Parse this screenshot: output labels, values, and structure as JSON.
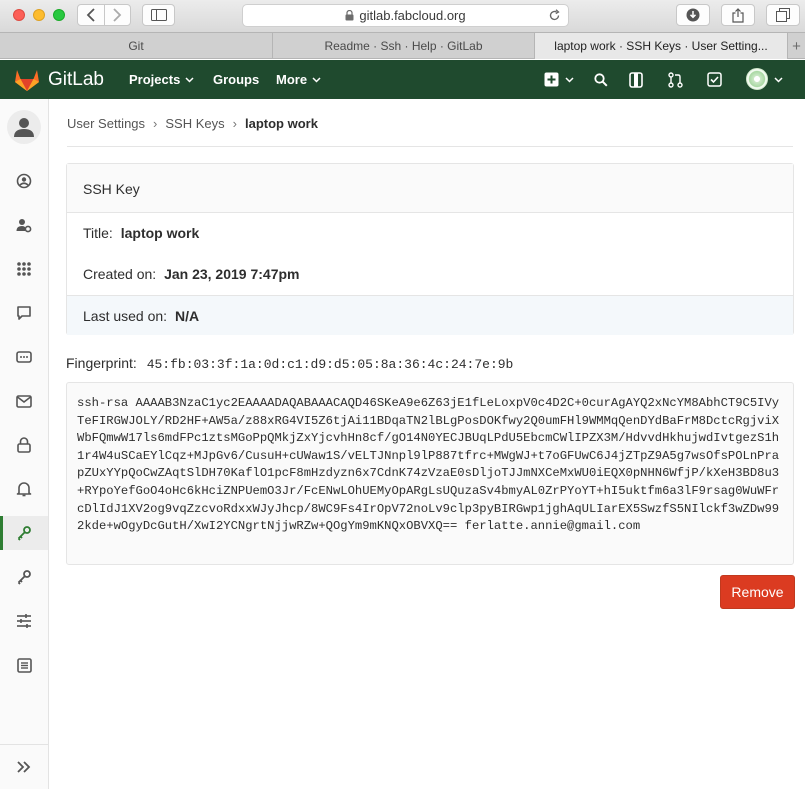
{
  "browser": {
    "url": "gitlab.fabcloud.org",
    "tabs": [
      {
        "label": "Git"
      },
      {
        "label": "Readme · Ssh · Help · GitLab"
      },
      {
        "label": "laptop work · SSH Keys · User Setting..."
      }
    ],
    "new_tab_label": "+"
  },
  "header": {
    "brand": "GitLab",
    "nav": [
      {
        "label": "Projects"
      },
      {
        "label": "Groups"
      },
      {
        "label": "More"
      }
    ],
    "colors": {
      "header_bg": "#1f4a2e",
      "danger": "#db3b21"
    }
  },
  "breadcrumb": {
    "items": [
      "User Settings",
      "SSH Keys",
      "laptop work"
    ]
  },
  "ssh_key": {
    "panel_title": "SSH Key",
    "title_label": "Title:",
    "title_value": "laptop work",
    "created_label": "Created on:",
    "created_value": "Jan 23, 2019 7:47pm",
    "last_used_label": "Last used on:",
    "last_used_value": "N/A",
    "fingerprint_label": "Fingerprint:",
    "fingerprint_value": "45:fb:03:3f:1a:0d:c1:d9:d5:05:8a:36:4c:24:7e:9b",
    "key_text": "ssh-rsa AAAAB3NzaC1yc2EAAAADAQABAAACAQD46SKeA9e6Z63jE1fLeLoxpV0c4D2C+0curAgAYQ2xNcYM8AbhCT9C5IVyTeFIRGWJOLY/RD2HF+AW5a/z88xRG4VI5Z6tjAi11BDqaTN2lBLgPosDOKfwy2Q0umFHl9WMMqQenDYdBaFrM8DctcRgjviXWbFQmwW17ls6mdFPc1ztsMGoPpQMkjZxYjcvhHn8cf/gO14N0YECJBUqLPdU5EbcmCWlIPZX3M/HdvvdHkhujwdIvtgezS1h1r4W4uSCaEYlCqz+MJpGv6/CusuH+cUWaw1S/vELTJNnpl9lP887tfrc+MWgWJ+t7oGFUwC6J4jZTpZ9A5g7wsOfsPOLnPrapZUxYYpQoCwZAqtSlDH70KaflO1pcF8mHzdyzn6x7CdnK74zVzaE0sDljoTJJmNXCeMxWU0iEQX0pNHN6WfjP/kXeH3BD8u3+RYpoYefGoO4oHc6kHciZNPUemO3Jr/FcENwLOhUEMyOpARgLsUQuzaSv4bmyAL0ZrPYoYT+hI5uktfm6a3lF9rsag0WuWFrcDlIdJ1XV2og9vqZzcvoRdxxWJyJhcp/8WC9Fs4IrOpV72noLv9clp3pyBIRGwp1jghAqULIarEX5SwzfS5NIlckf3wZDw992kde+wOgyDcGutH/XwI2YCNgrtNjjwRZw+QOgYm9mKNQxOBVXQ== ferlatte.annie@gmail.com",
    "remove_label": "Remove"
  }
}
